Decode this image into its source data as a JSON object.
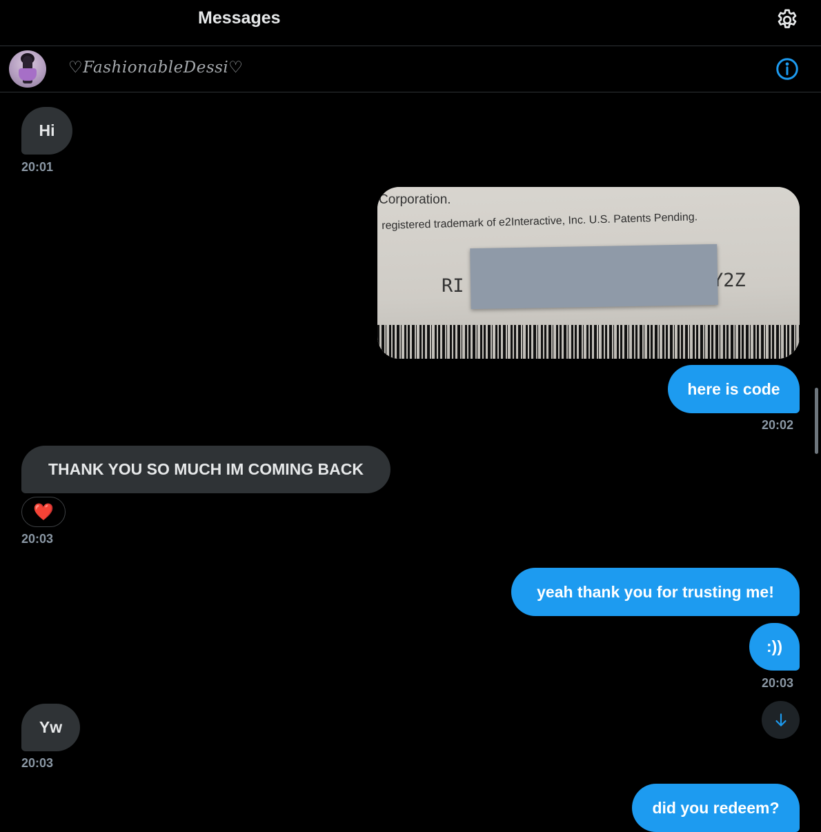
{
  "header": {
    "title": "Messages",
    "settings_icon": "gear-icon"
  },
  "conversation": {
    "contact_name": "♡FashionableDessi♡",
    "info_icon": "info-icon"
  },
  "messages": [
    {
      "direction": "incoming",
      "text": "Hi",
      "time": "20:01"
    },
    {
      "direction": "outgoing",
      "type": "image",
      "image_text": {
        "line1": "Corporation.",
        "line2": "registered trademark of e2Interactive, Inc. U.S. Patents Pending.",
        "code_start": "RI",
        "code_end": "Y2Z"
      }
    },
    {
      "direction": "outgoing",
      "text": "here is code",
      "time": "20:02"
    },
    {
      "direction": "incoming",
      "text": "THANK YOU SO MUCH IM COMING BACK",
      "reaction": "❤️",
      "time": "20:03"
    },
    {
      "direction": "outgoing",
      "text": "yeah thank you for trusting me!"
    },
    {
      "direction": "outgoing",
      "text": ":))",
      "time": "20:03"
    },
    {
      "direction": "incoming",
      "text": "Yw",
      "time": "20:03"
    },
    {
      "direction": "outgoing",
      "text": "did you redeem?"
    }
  ],
  "colors": {
    "background": "#000000",
    "outgoing_bubble": "#1d9bf0",
    "incoming_bubble": "#2f3336",
    "accent": "#1d9bf0"
  },
  "scroll_down_icon": "arrow-down-icon"
}
